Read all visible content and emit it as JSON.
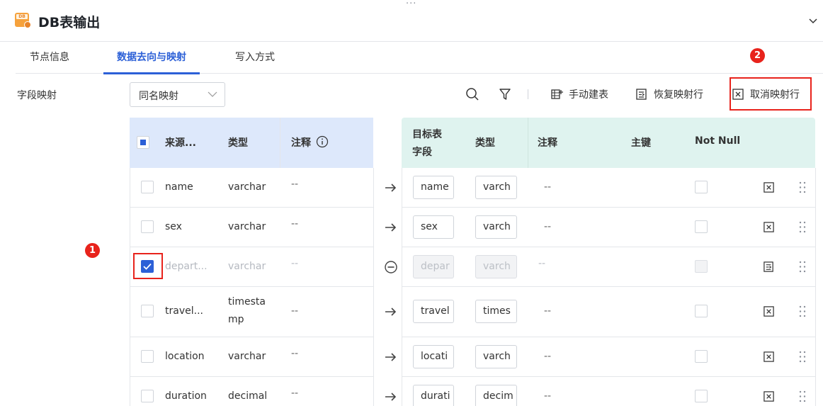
{
  "window": {
    "title": "DB表输出"
  },
  "tabs": [
    {
      "label": "节点信息"
    },
    {
      "label": "数据去向与映射"
    },
    {
      "label": "写入方式"
    }
  ],
  "badges": {
    "one": "1",
    "two": "2"
  },
  "toolbar": {
    "field_mapping_label": "字段映射",
    "mapping_select_value": "同名映射",
    "manual_create_label": "手动建表",
    "restore_mapping_label": "恢复映射行",
    "cancel_mapping_label": "取消映射行"
  },
  "left_table": {
    "headers": {
      "source": "来源...",
      "type": "类型",
      "comment": "注释"
    },
    "rows": [
      {
        "name": "name",
        "type": "varchar",
        "comment": "--",
        "checked": false
      },
      {
        "name": "sex",
        "type": "varchar",
        "comment": "--",
        "checked": false
      },
      {
        "name": "depart...",
        "type": "varchar",
        "comment": "--",
        "checked": true
      },
      {
        "name": "travel...",
        "type": "timesta\nmp",
        "type_line1": "timesta",
        "type_line2": "mp",
        "comment": "--",
        "checked": false
      },
      {
        "name": "location",
        "type": "varchar",
        "comment": "--",
        "checked": false
      },
      {
        "name": "duration",
        "type": "decimal",
        "comment": "--",
        "checked": false
      }
    ]
  },
  "right_table": {
    "headers": {
      "target_line1": "目标表",
      "target_line2": "字段",
      "type": "类型",
      "comment": "注释",
      "primary_key": "主键",
      "not_null": "Not Null"
    },
    "rows": [
      {
        "field": "name",
        "type": "varch",
        "comment": "--"
      },
      {
        "field": "sex",
        "type": "varch",
        "comment": "--"
      },
      {
        "field": "depar",
        "type": "varch",
        "comment": "--"
      },
      {
        "field": "travel",
        "type": "times",
        "comment": "--"
      },
      {
        "field": "locati",
        "type": "varch",
        "comment": "--"
      },
      {
        "field": "durati",
        "type": "decim",
        "comment": "--"
      }
    ]
  },
  "colors": {
    "accent": "#2c60d7",
    "highlight": "#e8231c",
    "left_header": "#dde8fb",
    "right_header": "#dff3ef"
  }
}
